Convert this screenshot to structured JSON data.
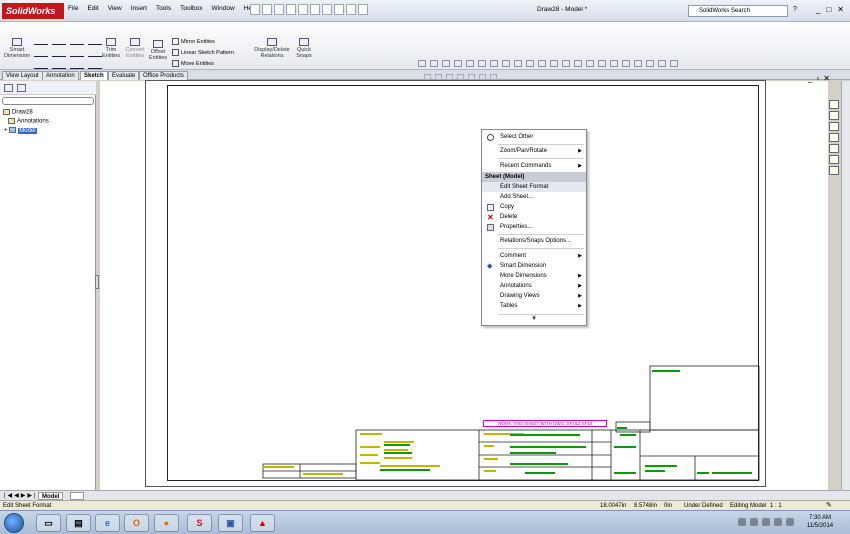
{
  "app": {
    "logo_text": "SolidWorks",
    "doc_title": "Draw28 - Model *",
    "menu": [
      "File",
      "Edit",
      "View",
      "Insert",
      "Tools",
      "Toolbox",
      "Window",
      "Help"
    ],
    "search_placeholder": "SolidWorks Search",
    "help_glyph": "?",
    "window_buttons": [
      "_",
      "□",
      "✕"
    ]
  },
  "command_manager": {
    "smart_dimension": "Smart Dimension",
    "trim_entities": "Trim Entities",
    "convert_entities": "Convert Entities",
    "offset_entities": "Offset Entities",
    "mirror_entities": "Mirror Entities",
    "linear_sketch_pattern": "Linear Sketch Pattern",
    "move_entities": "Move Entities",
    "display_delete_relations": "Display/Delete Relations",
    "quick_snaps": "Quick Snaps"
  },
  "tabs": [
    "View Layout",
    "Annotation",
    "Sketch",
    "Evaluate",
    "Office Products"
  ],
  "active_tab": "Sketch",
  "feature_tree": {
    "root": "Draw28",
    "items": [
      "Annotations",
      "Model"
    ]
  },
  "context_menu": {
    "items": [
      {
        "label": "Select Other",
        "icon": "select-other-icon"
      },
      {
        "label": "Zoom/Pan/Rotate",
        "submenu": true
      },
      {
        "label": "Recent Commands",
        "submenu": true
      },
      {
        "label": "Sheet (Model)",
        "header": true
      },
      {
        "label": "Edit Sheet Format",
        "highlight": true
      },
      {
        "label": "Add Sheet..."
      },
      {
        "label": "Copy",
        "icon": "copy-icon"
      },
      {
        "label": "Delete",
        "icon": "delete-icon"
      },
      {
        "label": "Properties...",
        "icon": "properties-icon"
      },
      {
        "label": "Relations/Snaps Options..."
      },
      {
        "label": "Comment",
        "submenu": true
      },
      {
        "label": "Smart Dimension",
        "icon": "smart-dimension-icon"
      },
      {
        "label": "More Dimensions",
        "submenu": true
      },
      {
        "label": "Annotations",
        "submenu": true
      },
      {
        "label": "Drawing Views",
        "submenu": true
      },
      {
        "label": "Tables",
        "submenu": true
      }
    ],
    "expand_glyph": "¥"
  },
  "drawing": {
    "note": "WORK THIS SHEET WITH DWG. SF1&2 SF18"
  },
  "sheet_tab": "Model",
  "status": {
    "message": "Edit Sheet Format",
    "x": "18.0047in",
    "y": "8.5748in",
    "z": "0in",
    "state": "Under Defined",
    "mode": "Editing Model",
    "scale": "1 : 1"
  },
  "taskbar": {
    "time": "7:30 AM",
    "date": "11/5/2014"
  }
}
